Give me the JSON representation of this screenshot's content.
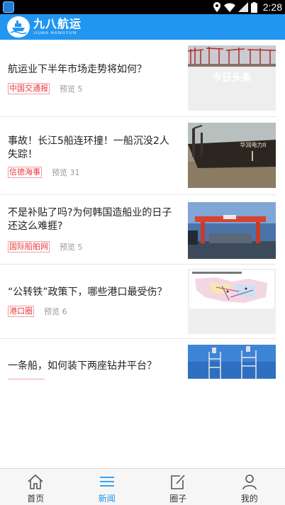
{
  "status_bar": {
    "time": "2:28"
  },
  "header": {
    "logo_cn": "九八航运",
    "logo_en": "JIUBA HANGYUN"
  },
  "articles": [
    {
      "title": "航运业下半年市场走势将如何？",
      "source": "中国交通报",
      "views": "预览 5",
      "image": "cranes-port-photo",
      "watermark": "今日头条"
    },
    {
      "title": "事故！长江5船连环撞！一船沉没2人失踪！",
      "source": "信德海事",
      "views": "预览 31",
      "image": "cargo-ship-photo",
      "hull_text": "华润电力8"
    },
    {
      "title": "不是补贴了吗?为何韩国造船业的日子还这么难捱?",
      "source": "国际船舶网",
      "views": "预览 5",
      "image": "shipyard-gantry-photo"
    },
    {
      "title": "“公转铁”政策下，哪些港口最受伤？",
      "source": "港口圈",
      "views": "预览 6",
      "image": "map-figure"
    },
    {
      "title": "一条船，如何装下两座钻井平台？",
      "source": "",
      "views": "",
      "image": "drilling-rig-photo"
    }
  ],
  "tabbar": {
    "active": "新闻",
    "items": [
      {
        "label": "首页",
        "icon": "home-icon"
      },
      {
        "label": "新闻",
        "icon": "news-list-icon"
      },
      {
        "label": "圈子",
        "icon": "edit-icon"
      },
      {
        "label": "我的",
        "icon": "profile-icon"
      }
    ]
  },
  "colors": {
    "primary": "#2196f0",
    "source_tag": "#e8383d",
    "meta_gray": "#999999",
    "statusbar": "#000000"
  }
}
